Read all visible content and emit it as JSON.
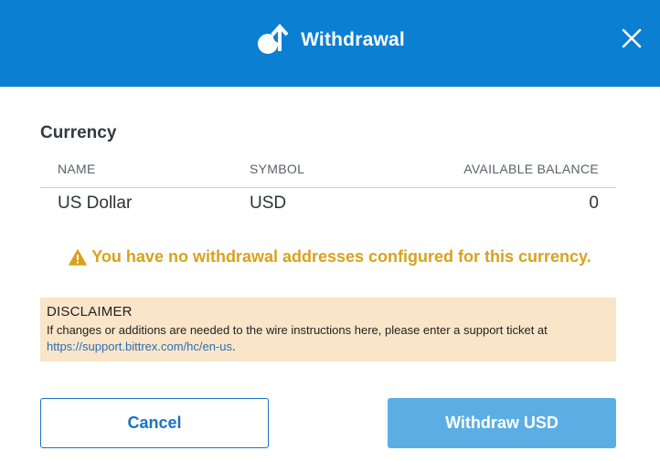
{
  "header": {
    "title": "Withdrawal",
    "icon": "withdrawal-icon",
    "close_icon": "close-icon",
    "background_color": "#0b7fd2"
  },
  "currency": {
    "section_label": "Currency",
    "columns": [
      "NAME",
      "SYMBOL",
      "AVAILABLE BALANCE"
    ],
    "rows": [
      {
        "name": "US Dollar",
        "symbol": "USD",
        "balance": "0"
      }
    ]
  },
  "warning": {
    "icon": "warning-icon",
    "text": "You have no withdrawal addresses configured for this currency.",
    "color": "#d9a21b"
  },
  "disclaimer": {
    "title": "DISCLAIMER",
    "text": "If changes or additions are needed to the wire instructions here, please enter a support ticket at",
    "link": "https://support.bittrex.com/hc/en-us",
    "trailing": ".",
    "background_color": "#fae5c9"
  },
  "buttons": {
    "cancel_label": "Cancel",
    "withdraw_label": "Withdraw USD"
  }
}
